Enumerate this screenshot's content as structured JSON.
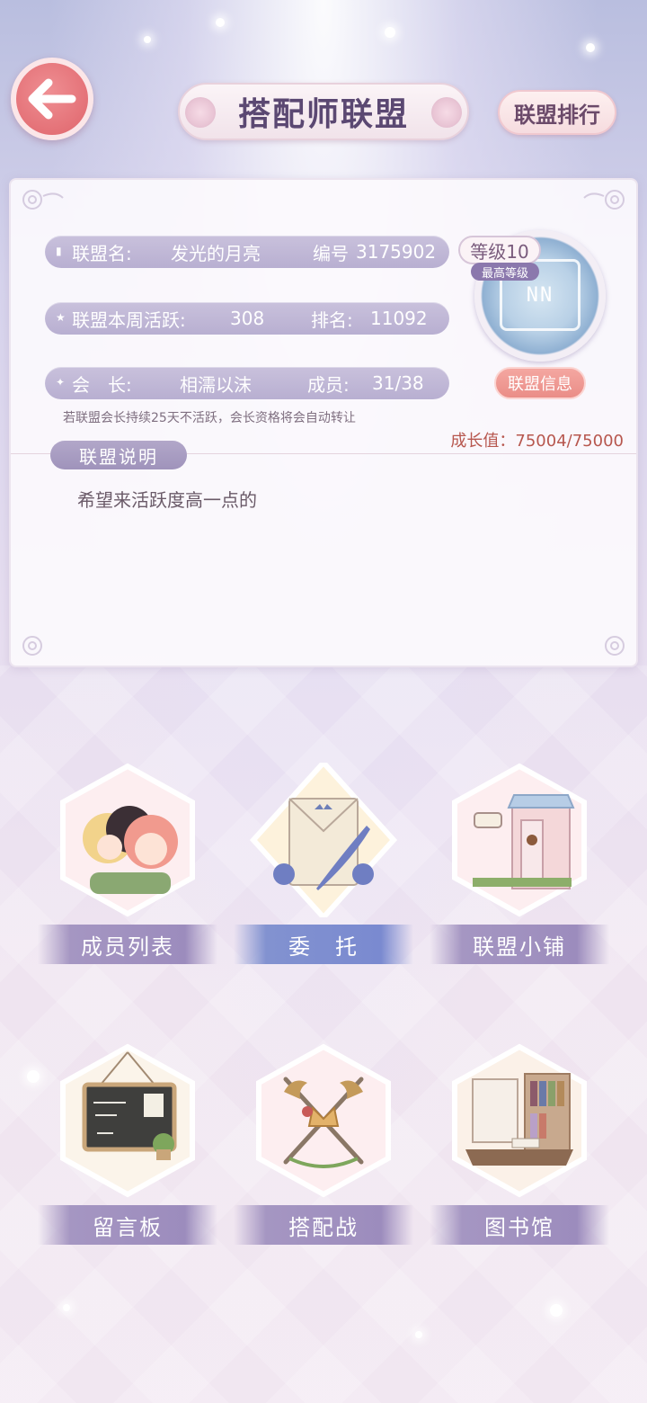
{
  "header": {
    "back_label": "",
    "title": "搭配师联盟",
    "rank_button": "联盟排行"
  },
  "alliance": {
    "name_label": "联盟名:",
    "name_value": "发光的月亮",
    "id_label": "编号",
    "id_value": "3175902",
    "activity_label": "联盟本周活跃:",
    "activity_value": "308",
    "rank_label": "排名:",
    "rank_value": "11092",
    "leader_label": "会　长:",
    "leader_value": "相濡以沫",
    "members_label": "成员:",
    "members_value": "31/38",
    "notice": "若联盟会长持续25天不活跃，会长资格将会自动转让",
    "growth_label": "成长值：",
    "growth_value": "75004/75000",
    "level_label": "等级10",
    "level_sub": "最高等级",
    "emblem_text": "NN",
    "info_button": "联盟信息",
    "description_tag": "联盟说明",
    "description_text": "希望来活跃度高一点的"
  },
  "features": [
    {
      "label": "成员列表",
      "icon": "girls-portrait-icon"
    },
    {
      "label": "委　托",
      "icon": "envelope-quill-icon"
    },
    {
      "label": "联盟小铺",
      "icon": "shop-icon"
    },
    {
      "label": "留言板",
      "icon": "chalkboard-icon"
    },
    {
      "label": "搭配战",
      "icon": "crest-swords-icon"
    },
    {
      "label": "图书馆",
      "icon": "library-icon"
    }
  ],
  "colors": {
    "accent_purple": "#9c8cbd",
    "back_button": "#e47177",
    "info_button": "#ea8d87",
    "growth_text": "#b7574e"
  }
}
